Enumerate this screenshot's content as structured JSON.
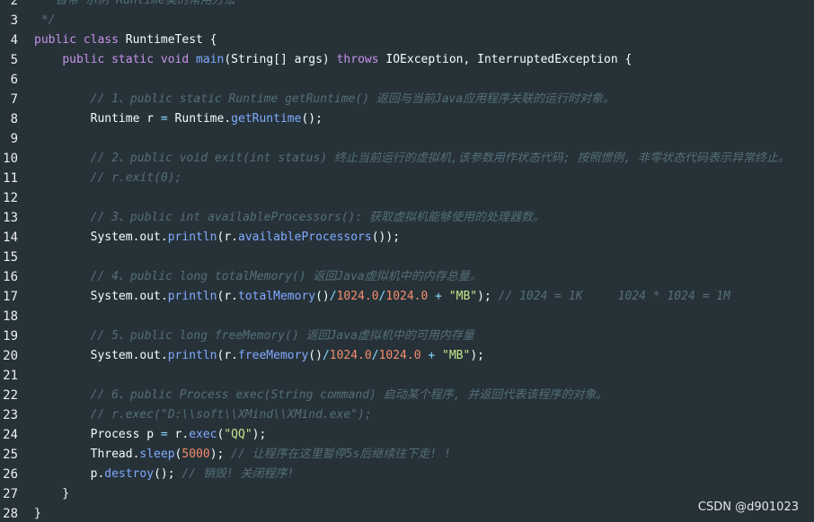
{
  "colors": {
    "background": "#263238",
    "keyword": "#c792ea",
    "function": "#82aaff",
    "number": "#f78c6c",
    "string": "#c3e88d",
    "operator": "#89ddff",
    "plain": "#eeffff",
    "comment": "#546e7a",
    "line_number": "#eceff1"
  },
  "editor": {
    "lines": [
      {
        "n": "2",
        "tokens": [
          {
            "t": "cm",
            "v": "   自带 示例 Runtime类的常用方法"
          }
        ]
      },
      {
        "n": "3",
        "tokens": [
          {
            "t": "cm",
            "v": " */"
          }
        ]
      },
      {
        "n": "4",
        "tokens": [
          {
            "t": "kw",
            "v": "public"
          },
          {
            "t": "pl",
            "v": " "
          },
          {
            "t": "kw",
            "v": "class"
          },
          {
            "t": "pl",
            "v": " RuntimeTest {"
          }
        ]
      },
      {
        "n": "5",
        "tokens": [
          {
            "t": "pl",
            "v": "    "
          },
          {
            "t": "kw",
            "v": "public"
          },
          {
            "t": "pl",
            "v": " "
          },
          {
            "t": "kw",
            "v": "static"
          },
          {
            "t": "pl",
            "v": " "
          },
          {
            "t": "kw",
            "v": "void"
          },
          {
            "t": "pl",
            "v": " "
          },
          {
            "t": "fn",
            "v": "main"
          },
          {
            "t": "pl",
            "v": "(String[] args) "
          },
          {
            "t": "kw",
            "v": "throws"
          },
          {
            "t": "pl",
            "v": " IOException, InterruptedException {"
          }
        ]
      },
      {
        "n": "6",
        "tokens": []
      },
      {
        "n": "7",
        "tokens": [
          {
            "t": "pl",
            "v": "        "
          },
          {
            "t": "cm",
            "v": "// 1、public static Runtime getRuntime() 返回与当前Java应用程序关联的运行时对象。"
          }
        ]
      },
      {
        "n": "8",
        "tokens": [
          {
            "t": "pl",
            "v": "        Runtime r "
          },
          {
            "t": "op",
            "v": "="
          },
          {
            "t": "pl",
            "v": " Runtime."
          },
          {
            "t": "fn",
            "v": "getRuntime"
          },
          {
            "t": "pl",
            "v": "();"
          }
        ]
      },
      {
        "n": "9",
        "tokens": []
      },
      {
        "n": "10",
        "tokens": [
          {
            "t": "pl",
            "v": "        "
          },
          {
            "t": "cm",
            "v": "// 2、public void exit(int status) 终止当前运行的虚拟机,该参数用作状态代码; 按照惯例, 非零状态代码表示异常终止。"
          }
        ]
      },
      {
        "n": "11",
        "tokens": [
          {
            "t": "pl",
            "v": "        "
          },
          {
            "t": "cm",
            "v": "// r.exit(0);"
          }
        ]
      },
      {
        "n": "12",
        "tokens": []
      },
      {
        "n": "13",
        "tokens": [
          {
            "t": "pl",
            "v": "        "
          },
          {
            "t": "cm",
            "v": "// 3、public int availableProcessors(): 获取虚拟机能够使用的处理器数。"
          }
        ]
      },
      {
        "n": "14",
        "tokens": [
          {
            "t": "pl",
            "v": "        System.out."
          },
          {
            "t": "fn",
            "v": "println"
          },
          {
            "t": "pl",
            "v": "(r."
          },
          {
            "t": "fn",
            "v": "availableProcessors"
          },
          {
            "t": "pl",
            "v": "());"
          }
        ]
      },
      {
        "n": "15",
        "tokens": []
      },
      {
        "n": "16",
        "tokens": [
          {
            "t": "pl",
            "v": "        "
          },
          {
            "t": "cm",
            "v": "// 4、public long totalMemory() 返回Java虚拟机中的内存总量。"
          }
        ]
      },
      {
        "n": "17",
        "tokens": [
          {
            "t": "pl",
            "v": "        System.out."
          },
          {
            "t": "fn",
            "v": "println"
          },
          {
            "t": "pl",
            "v": "(r."
          },
          {
            "t": "fn",
            "v": "totalMemory"
          },
          {
            "t": "pl",
            "v": "()"
          },
          {
            "t": "op",
            "v": "/"
          },
          {
            "t": "num",
            "v": "1024.0"
          },
          {
            "t": "op",
            "v": "/"
          },
          {
            "t": "num",
            "v": "1024.0"
          },
          {
            "t": "pl",
            "v": " "
          },
          {
            "t": "op",
            "v": "+"
          },
          {
            "t": "pl",
            "v": " "
          },
          {
            "t": "str",
            "v": "\"MB\""
          },
          {
            "t": "pl",
            "v": "); "
          },
          {
            "t": "cm",
            "v": "// 1024 = 1K     1024 * 1024 = 1M"
          }
        ]
      },
      {
        "n": "18",
        "tokens": []
      },
      {
        "n": "19",
        "tokens": [
          {
            "t": "pl",
            "v": "        "
          },
          {
            "t": "cm",
            "v": "// 5、public long freeMemory() 返回Java虚拟机中的可用内存量"
          }
        ]
      },
      {
        "n": "20",
        "tokens": [
          {
            "t": "pl",
            "v": "        System.out."
          },
          {
            "t": "fn",
            "v": "println"
          },
          {
            "t": "pl",
            "v": "(r."
          },
          {
            "t": "fn",
            "v": "freeMemory"
          },
          {
            "t": "pl",
            "v": "()"
          },
          {
            "t": "op",
            "v": "/"
          },
          {
            "t": "num",
            "v": "1024.0"
          },
          {
            "t": "op",
            "v": "/"
          },
          {
            "t": "num",
            "v": "1024.0"
          },
          {
            "t": "pl",
            "v": " "
          },
          {
            "t": "op",
            "v": "+"
          },
          {
            "t": "pl",
            "v": " "
          },
          {
            "t": "str",
            "v": "\"MB\""
          },
          {
            "t": "pl",
            "v": ");"
          }
        ]
      },
      {
        "n": "21",
        "tokens": []
      },
      {
        "n": "22",
        "tokens": [
          {
            "t": "pl",
            "v": "        "
          },
          {
            "t": "cm",
            "v": "// 6、public Process exec(String command) 启动某个程序, 并返回代表该程序的对象。"
          }
        ]
      },
      {
        "n": "23",
        "tokens": [
          {
            "t": "pl",
            "v": "        "
          },
          {
            "t": "cm",
            "v": "// r.exec(\"D:\\\\soft\\\\XMind\\\\XMind.exe\");"
          }
        ]
      },
      {
        "n": "24",
        "tokens": [
          {
            "t": "pl",
            "v": "        Process p "
          },
          {
            "t": "op",
            "v": "="
          },
          {
            "t": "pl",
            "v": " r."
          },
          {
            "t": "fn",
            "v": "exec"
          },
          {
            "t": "pl",
            "v": "("
          },
          {
            "t": "str",
            "v": "\"QQ\""
          },
          {
            "t": "pl",
            "v": ");"
          }
        ]
      },
      {
        "n": "25",
        "tokens": [
          {
            "t": "pl",
            "v": "        Thread."
          },
          {
            "t": "fn",
            "v": "sleep"
          },
          {
            "t": "pl",
            "v": "("
          },
          {
            "t": "num",
            "v": "5000"
          },
          {
            "t": "pl",
            "v": "); "
          },
          {
            "t": "cm",
            "v": "// 让程序在这里暂停5s后继续往下走! !"
          }
        ]
      },
      {
        "n": "26",
        "tokens": [
          {
            "t": "pl",
            "v": "        p."
          },
          {
            "t": "fn",
            "v": "destroy"
          },
          {
            "t": "pl",
            "v": "(); "
          },
          {
            "t": "cm",
            "v": "// 销毁! 关闭程序!"
          }
        ]
      },
      {
        "n": "27",
        "tokens": [
          {
            "t": "pl",
            "v": "    }"
          }
        ]
      },
      {
        "n": "28",
        "tokens": [
          {
            "t": "pl",
            "v": "}"
          }
        ]
      }
    ]
  },
  "watermark": "CSDN @d901023"
}
